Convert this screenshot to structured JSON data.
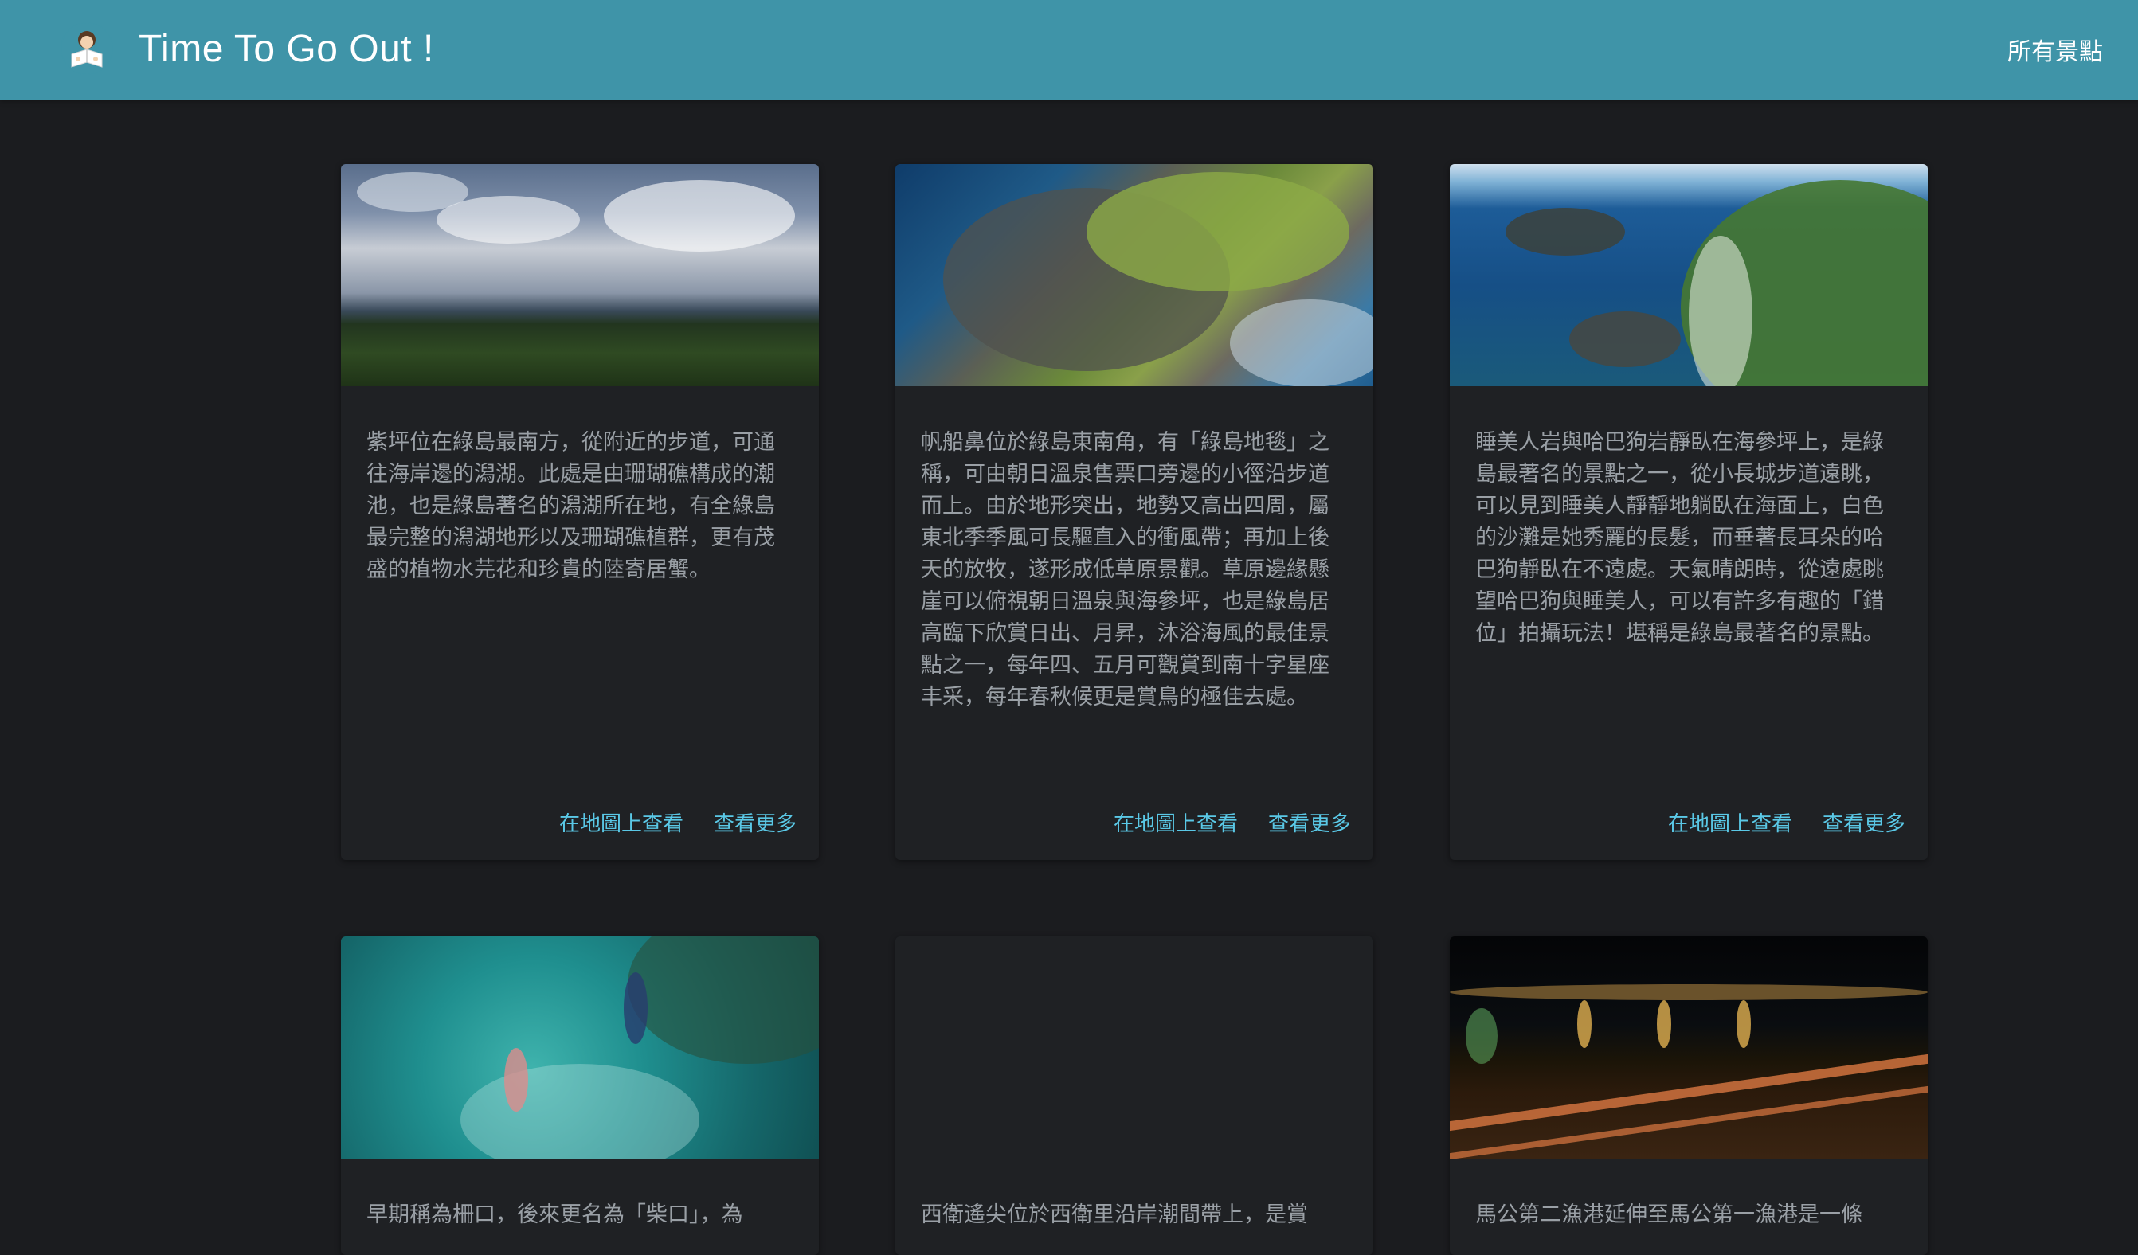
{
  "navbar": {
    "brand_title": "Time To Go Out !",
    "all_spots_link": "所有景點"
  },
  "cards": [
    {
      "description": "紫坪位在綠島最南方，從附近的步道，可通往海岸邊的潟湖。此處是由珊瑚礁構成的潮池，也是綠島著名的潟湖所在地，有全綠島最完整的潟湖地形以及珊瑚礁植群，更有茂盛的植物水芫花和珍貴的陸寄居蟹。",
      "map_link": "在地圖上查看",
      "more_link": "查看更多"
    },
    {
      "description": "帆船鼻位於綠島東南角，有「綠島地毯」之稱，可由朝日溫泉售票口旁邊的小徑沿步道而上。由於地形突出，地勢又高出四周，屬東北季季風可長驅直入的衝風帶；再加上後天的放牧，遂形成低草原景觀。草原邊緣懸崖可以俯視朝日溫泉與海參坪，也是綠島居高臨下欣賞日出、月昇，沐浴海風的最佳景點之一，每年四、五月可觀賞到南十字星座丰采，每年春秋候更是賞鳥的極佳去處。",
      "map_link": "在地圖上查看",
      "more_link": "查看更多"
    },
    {
      "description": "睡美人岩與哈巴狗岩靜臥在海參坪上，是綠島最著名的景點之一，從小長城步道遠眺，可以見到睡美人靜靜地躺臥在海面上，白色的沙灘是她秀麗的長髮，而垂著長耳朵的哈巴狗靜臥在不遠處。天氣晴朗時，從遠處眺望哈巴狗與睡美人，可以有許多有趣的「錯位」拍攝玩法！堪稱是綠島最著名的景點。",
      "map_link": "在地圖上查看",
      "more_link": "查看更多"
    },
    {
      "description": "早期稱為柵口，後來更名為「柴口」，為"
    },
    {
      "description": "西衛遙尖位於西衛里沿岸潮間帶上，是賞"
    },
    {
      "description": "馬公第二漁港延伸至馬公第一漁港是一條"
    }
  ]
}
